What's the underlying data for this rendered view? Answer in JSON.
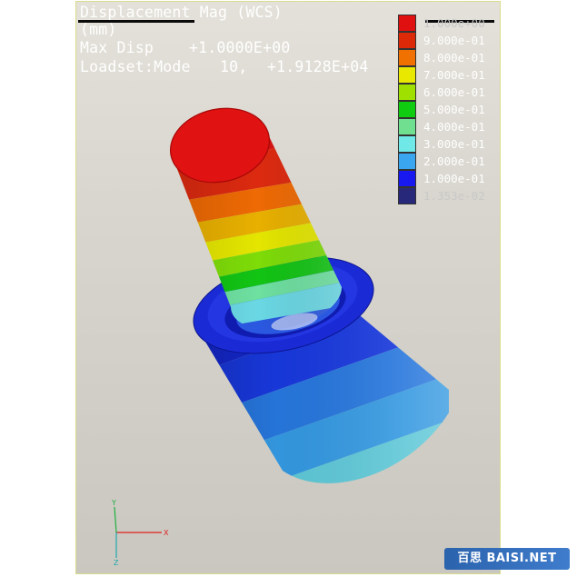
{
  "header": {
    "title": "Displacement Mag (WCS)",
    "units": "(mm)",
    "max_disp_label": "Max Disp",
    "max_disp_value": "+1.0000E+00",
    "loadset_label": "Loadset:Mode",
    "mode_number": "10,",
    "frequency_value": "+1.9128E+04"
  },
  "legend": [
    {
      "label": "1.000e+00",
      "color": "#e01010"
    },
    {
      "label": "9.000e-01",
      "color": "#dc2a08"
    },
    {
      "label": "8.000e-01",
      "color": "#f07000"
    },
    {
      "label": "7.000e-01",
      "color": "#e8e800"
    },
    {
      "label": "6.000e-01",
      "color": "#a0e000"
    },
    {
      "label": "5.000e-01",
      "color": "#10cc10"
    },
    {
      "label": "4.000e-01",
      "color": "#70e090"
    },
    {
      "label": "3.000e-01",
      "color": "#70e8e8"
    },
    {
      "label": "2.000e-01",
      "color": "#3aa6f0"
    },
    {
      "label": "1.000e-01",
      "color": "#1818f0"
    },
    {
      "label": "1.353e-02",
      "color": "#28287a"
    }
  ],
  "triad": {
    "y_label": "Y",
    "x_label": "X",
    "z_label": "Z"
  },
  "watermark": {
    "text": "百思 BAISI.NET"
  }
}
